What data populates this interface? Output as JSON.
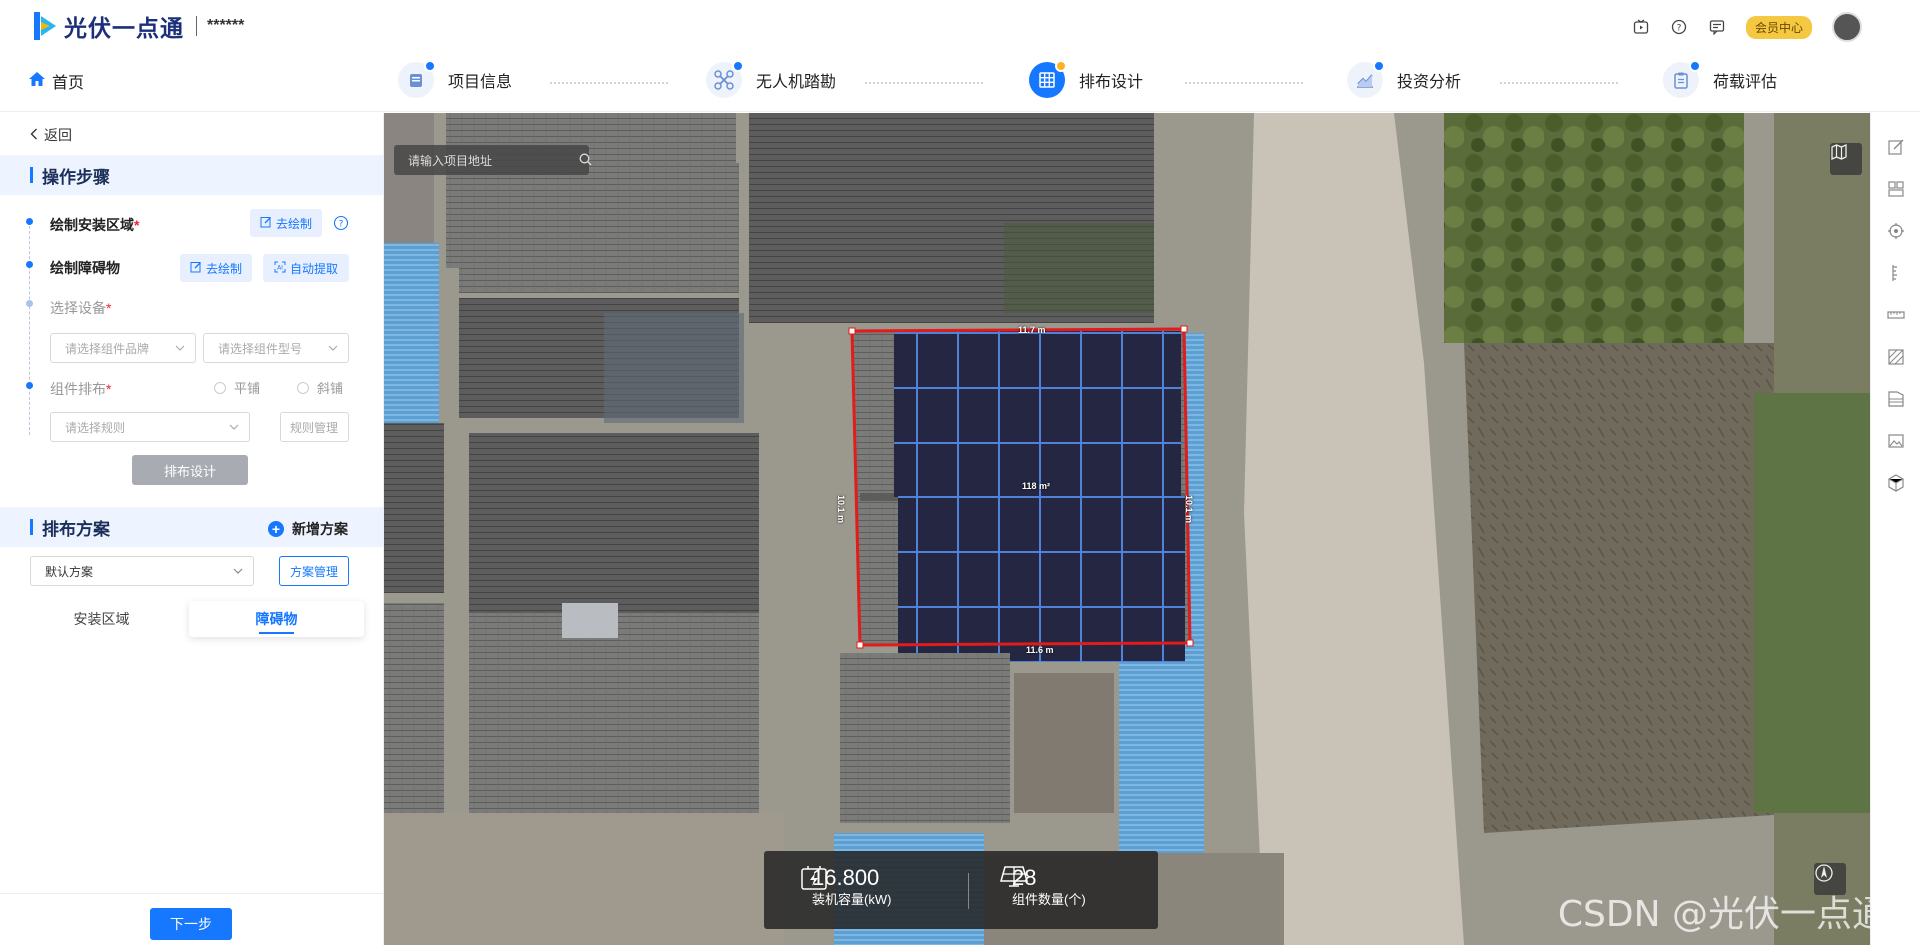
{
  "brand": {
    "name": "光伏一点通",
    "masked": "******"
  },
  "top_right": {
    "vip_label": "会员中心"
  },
  "nav": {
    "home": "首页",
    "steps": [
      {
        "label": "项目信息"
      },
      {
        "label": "无人机踏勘"
      },
      {
        "label": "排布设计"
      },
      {
        "label": "投资分析"
      },
      {
        "label": "荷载评估"
      }
    ],
    "active_step": "排布设计"
  },
  "left": {
    "back": "返回",
    "ops_title": "操作步骤",
    "step1": {
      "label": "绘制安装区域",
      "btn": "去绘制"
    },
    "step2": {
      "label": "绘制障碍物",
      "btn_draw": "去绘制",
      "btn_auto": "自动提取"
    },
    "step3": {
      "label": "选择设备",
      "brand_ph": "请选择组件品牌",
      "model_ph": "请选择组件型号"
    },
    "step4": {
      "label": "组件排布",
      "opt_flat": "平铺",
      "opt_tilt": "斜铺",
      "rule_ph": "请选择规则",
      "rule_btn": "规则管理"
    },
    "design_btn": "排布设计",
    "plan_title": "排布方案",
    "add_plan": "新增方案",
    "plan_value": "默认方案",
    "plan_manage": "方案管理",
    "tabs": [
      "安装区域",
      "障碍物"
    ],
    "active_tab": "障碍物",
    "next": "下一步"
  },
  "map": {
    "search_placeholder": "请输入项目地址",
    "dims": {
      "top": "11.7 m",
      "bottom": "11.6 m",
      "left": "10.1 m",
      "right": "10.1 m",
      "area": "118 m²"
    },
    "stats": {
      "capacity_value": "16.800",
      "capacity_label": "装机容量(kW)",
      "count_value": "28",
      "count_label": "组件数量(个)"
    },
    "watermark": "CSDN @光伏一点通"
  },
  "colors": {
    "accent": "#1677ff",
    "outline": "#e21b1b",
    "panel": "#1e2140"
  }
}
